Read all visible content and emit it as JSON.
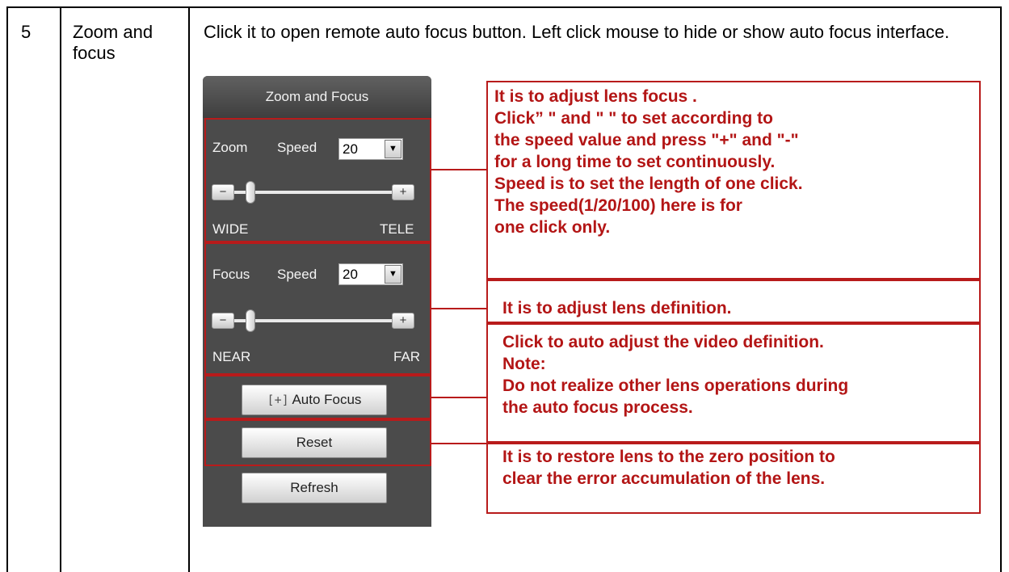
{
  "row": {
    "number": "5",
    "name": "Zoom and focus",
    "description": "Click it to open remote auto focus button. Left click mouse to hide or show auto focus interface."
  },
  "panel": {
    "title": "Zoom and Focus",
    "zoom": {
      "label": "Zoom",
      "speed_label": "Speed",
      "speed_value": "20",
      "minus": "−",
      "plus": "+",
      "left_label": "WIDE",
      "right_label": "TELE"
    },
    "focus": {
      "label": "Focus",
      "speed_label": "Speed",
      "speed_value": "20",
      "minus": "−",
      "plus": "+",
      "left_label": "NEAR",
      "right_label": "FAR"
    },
    "auto_focus_icon": "[+]",
    "auto_focus_label": "Auto Focus",
    "reset_label": "Reset",
    "refresh_label": "Refresh"
  },
  "annotations": {
    "zoom": [
      "It is to adjust lens focus .",
      "Click”  \" and \"  \" to set according to",
      "the speed value and press \"+\" and \"-\"",
      "for a long time to set continuously.",
      "Speed is to set the length of one click.",
      "The speed(1/20/100) here is for",
      "one click only."
    ],
    "focus": "It is to adjust lens definition.",
    "auto_focus": [
      "Click to auto adjust the video definition.",
      "Note:",
      "Do not realize other lens operations during",
      "the auto focus process."
    ],
    "reset": [
      "It is to restore lens to the zero position to",
      "clear the error accumulation of the lens."
    ]
  },
  "colors": {
    "annotation_red": "#b81b1b",
    "panel_bg": "#4b4b4b"
  }
}
